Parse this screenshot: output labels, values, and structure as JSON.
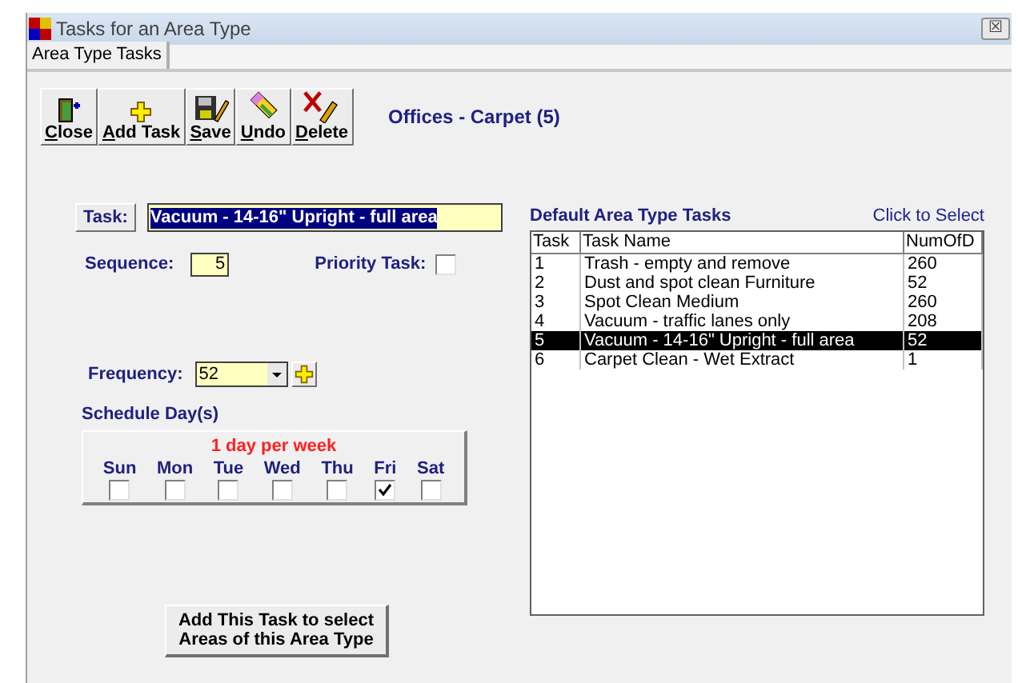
{
  "window": {
    "title": "Tasks for an Area Type",
    "close": "☒"
  },
  "tabs": [
    {
      "label": "Area Type Tasks",
      "selected": true
    }
  ],
  "toolbar": [
    {
      "kind": "close",
      "label": "Close"
    },
    {
      "kind": "add",
      "label": "Add Task"
    },
    {
      "kind": "save",
      "label": "Save"
    },
    {
      "kind": "undo",
      "label": "Undo"
    },
    {
      "kind": "delete",
      "label": "Delete"
    }
  ],
  "heading": "Offices - Carpet (5)",
  "task": {
    "button": "Task:",
    "value": "Vacuum - 14-16\" Upright - full area"
  },
  "sequence": {
    "label": "Sequence:",
    "value": "5"
  },
  "priority": {
    "label": "Priority Task:",
    "checked": false
  },
  "frequency": {
    "label": "Frequency:",
    "value": "52"
  },
  "schedule": {
    "label": "Schedule Day(s)",
    "summary": "1 day per week",
    "days": [
      {
        "label": "Sun",
        "checked": false
      },
      {
        "label": "Mon",
        "checked": false
      },
      {
        "label": "Tue",
        "checked": false
      },
      {
        "label": "Wed",
        "checked": false
      },
      {
        "label": "Thu",
        "checked": false
      },
      {
        "label": "Fri",
        "checked": true
      },
      {
        "label": "Sat",
        "checked": false
      }
    ]
  },
  "add_button": "Add This Task to select Areas of this Area Type",
  "defaults": {
    "title": "Default Area Type Tasks",
    "hint": "Click to Select",
    "columns": [
      "Task",
      "Task Name",
      "NumOfD"
    ],
    "rows": [
      {
        "cells": [
          "1",
          "Trash - empty and remove",
          "260"
        ],
        "selected": false
      },
      {
        "cells": [
          "2",
          "Dust and spot clean Furniture",
          "52"
        ],
        "selected": false
      },
      {
        "cells": [
          "3",
          "Spot Clean Medium",
          "260"
        ],
        "selected": false
      },
      {
        "cells": [
          "4",
          "Vacuum - traffic lanes only",
          "208"
        ],
        "selected": false
      },
      {
        "cells": [
          "5",
          "Vacuum - 14-16\" Upright - full area",
          "52"
        ],
        "selected": true
      },
      {
        "cells": [
          "6",
          "Carpet Clean - Wet Extract",
          "1"
        ],
        "selected": false
      }
    ]
  }
}
